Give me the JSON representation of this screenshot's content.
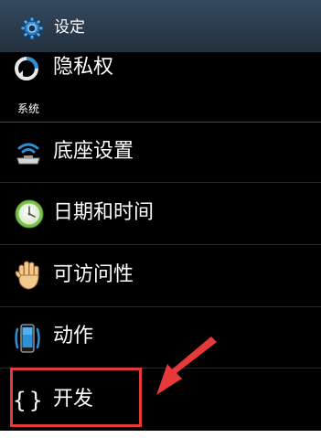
{
  "action_bar": {
    "title": "设定",
    "icon": "gear-icon"
  },
  "rows": [
    {
      "label": "隐私权",
      "icon": "privacy-icon"
    },
    {
      "label": "底座设置",
      "icon": "dock-icon"
    },
    {
      "label": "日期和时间",
      "icon": "clock-icon"
    },
    {
      "label": "可访问性",
      "icon": "hand-icon"
    },
    {
      "label": "动作",
      "icon": "motion-icon"
    },
    {
      "label": "开发",
      "icon": "braces-icon"
    }
  ],
  "section_header": "系统",
  "highlight": {
    "box_color": "#e8393a",
    "arrow_color": "#e8393a",
    "target": "开发"
  },
  "colors": {
    "background": "#000000",
    "action_bar": "#2b3b4d",
    "text": "#ffffff",
    "accent": "#2f8fd4"
  }
}
